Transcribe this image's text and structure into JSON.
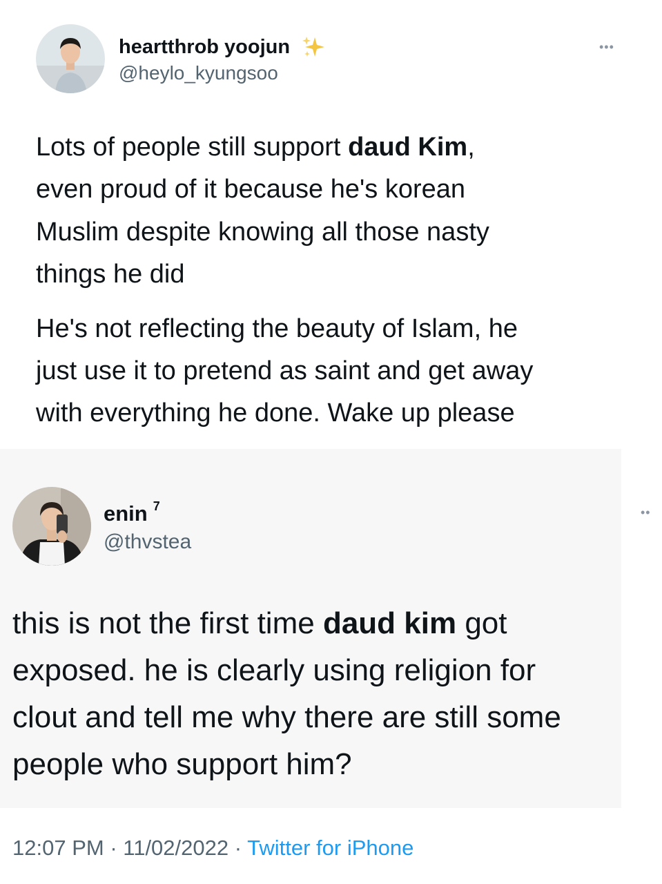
{
  "tweet1": {
    "display_name": "heartthrob yoojun",
    "name_badge_icon": "sparkles-icon",
    "handle": "@heylo_kyungsoo",
    "more_label": "•••",
    "paragraph1_lines": [
      {
        "before": "Lots of people still support ",
        "bold": "daud Kim",
        "after": ","
      },
      {
        "text": "even proud of it because he's korean"
      },
      {
        "text": "Muslim despite knowing all those nasty"
      },
      {
        "text": "things he did"
      }
    ],
    "paragraph2_lines": [
      "He's not reflecting the beauty of Islam, he",
      "just use it to pretend as saint and get away",
      "with everything he done. Wake up please"
    ]
  },
  "tweet2": {
    "display_name": "enin",
    "name_superscript": "7",
    "handle": "@thvstea",
    "more_label": "••",
    "lines": [
      {
        "before": "this is not the first time ",
        "bold": "daud kim",
        "after": " got"
      },
      {
        "text": "exposed. he is clearly using religion for"
      },
      {
        "text": "clout and tell me why there are still some"
      },
      {
        "text": "people who support him?"
      }
    ]
  },
  "footer": {
    "time": "12:07 PM",
    "separator": " · ",
    "date": "11/02/2022",
    "source": "Twitter for iPhone"
  },
  "colors": {
    "text": "#0f1419",
    "secondary": "#536471",
    "link": "#1d9bf0",
    "sparkle": "#f4c542"
  }
}
